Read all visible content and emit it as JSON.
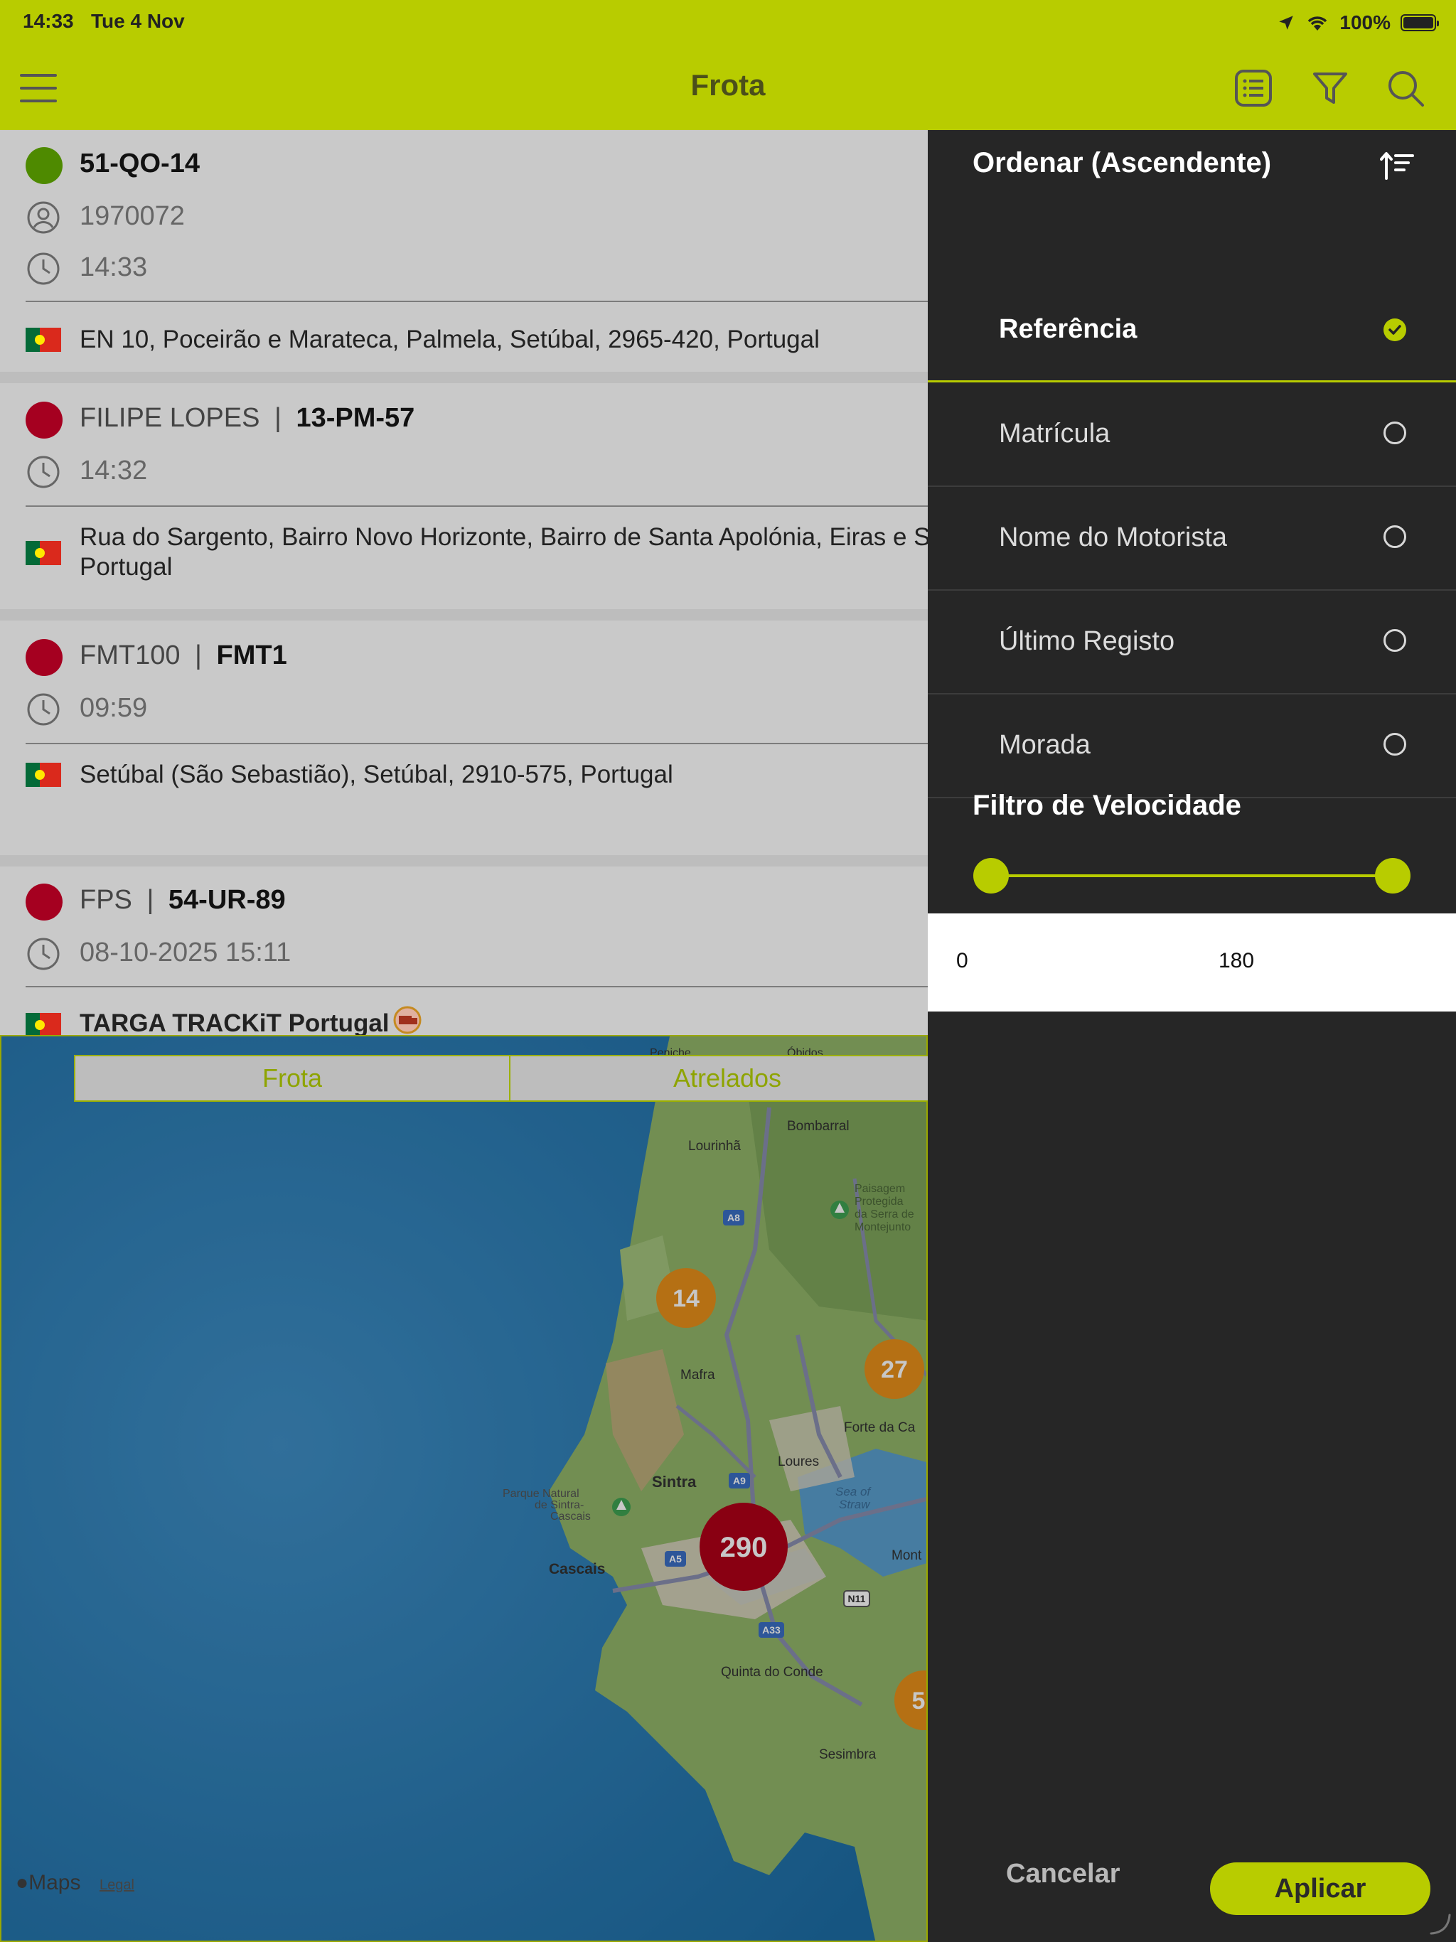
{
  "status_bar": {
    "time": "14:33",
    "date": "Tue 4 Nov",
    "battery": "100%"
  },
  "header": {
    "title": "Frota",
    "icons": [
      "menu-icon",
      "list-icon",
      "filter-icon",
      "search-icon"
    ]
  },
  "vehicles": [
    {
      "status": "green",
      "reference": "",
      "plate": "51-QO-14",
      "driver_id": "1970072",
      "time": "14:33",
      "address": "EN 10, Poceirão e Marateca, Palmela, Setúbal, 2965-420, Portugal"
    },
    {
      "status": "red",
      "reference": "FILIPE LOPES",
      "plate": "13-PM-57",
      "time": "14:32",
      "address_line1": "Rua do Sargento, Bairro Novo Horizonte, Bairro de Santa Apolónia, Eiras e São",
      "address_line2": "Portugal"
    },
    {
      "status": "red",
      "reference": "FMT100",
      "plate": "FMT1",
      "time": "09:59",
      "address": "Setúbal (São Sebastião), Setúbal, 2910-575, Portugal"
    },
    {
      "status": "red",
      "reference": "FPS",
      "plate": "54-UR-89",
      "time": "08-10-2025 15:11",
      "address": "TARGA TRACKiT Portugal"
    }
  ],
  "separator": "|",
  "map": {
    "tabs": [
      "Frota",
      "Atrelados"
    ],
    "clusters": [
      {
        "count": "14",
        "color": "#e8901a"
      },
      {
        "count": "27",
        "color": "#e8901a"
      },
      {
        "count": "290",
        "color": "#b00018"
      },
      {
        "count": "5",
        "color": "#e8901a"
      }
    ],
    "places": [
      "Bombarral",
      "Lourinhã",
      "Paisagem",
      "Protegida",
      "da Serra de",
      "Montejunto",
      "Mafra",
      "Forte da Ca",
      "Loures",
      "Sintra",
      "Parque Natural",
      "de Sintra-",
      "Cascais",
      "Sea of",
      "Straw",
      "Cascais",
      "Mont",
      "Quinta do Conde",
      "Sesimbra",
      "Peniche",
      "Óbidos"
    ],
    "roads": [
      "A8",
      "A9",
      "A5",
      "A33",
      "N11"
    ],
    "brand": "Maps",
    "legal": "Legal"
  },
  "sort_panel": {
    "title": "Ordenar (Ascendente)",
    "options": [
      {
        "label": "Referência",
        "selected": true
      },
      {
        "label": "Matrícula",
        "selected": false
      },
      {
        "label": "Nome do Motorista",
        "selected": false
      },
      {
        "label": "Último Registo",
        "selected": false
      },
      {
        "label": "Morada",
        "selected": false
      }
    ],
    "speed_filter": {
      "title": "Filtro de Velocidade",
      "min": "0",
      "max": "180"
    },
    "cancel": "Cancelar",
    "apply": "Aplicar",
    "accent": "#b8cc00"
  }
}
